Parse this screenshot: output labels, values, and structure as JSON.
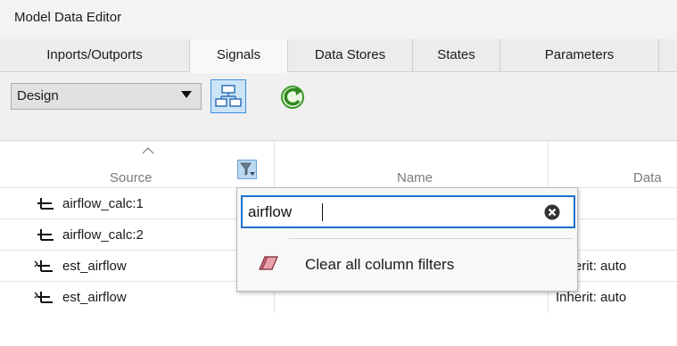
{
  "window": {
    "title": "Model Data Editor"
  },
  "tabs": [
    {
      "label": "Inports/Outports",
      "active": false
    },
    {
      "label": "Signals",
      "active": true
    },
    {
      "label": "Data Stores",
      "active": false
    },
    {
      "label": "States",
      "active": false
    },
    {
      "label": "Parameters",
      "active": false
    }
  ],
  "toolbar": {
    "view_select": {
      "value": "Design",
      "icon": "chevron-down-icon"
    },
    "hierarchy_toggle": {
      "icon": "hierarchy-icon",
      "pressed": true
    },
    "refresh": {
      "icon": "refresh-icon"
    }
  },
  "table": {
    "columns": [
      {
        "label": "Source",
        "sorted": true
      },
      {
        "label": "Name"
      },
      {
        "label": "Data"
      }
    ],
    "rows": [
      {
        "source": "airflow_calc:1",
        "name": "",
        "data": "",
        "icon": "signal-output-icon"
      },
      {
        "source": "airflow_calc:2",
        "name": "",
        "data": "",
        "icon": "signal-output-icon"
      },
      {
        "source": "est_airflow",
        "name": "",
        "data": "Inherit: auto",
        "icon": "signal-input-output-icon"
      },
      {
        "source": "est_airflow",
        "name": "",
        "data": "Inherit: auto",
        "icon": "signal-input-output-icon"
      }
    ]
  },
  "filter_popup": {
    "input_value": "airflow",
    "clear_all_label": "Clear all column filters",
    "colors": {
      "focus_border": "#1e6fd1",
      "eraser": "#e8a0aa"
    }
  }
}
